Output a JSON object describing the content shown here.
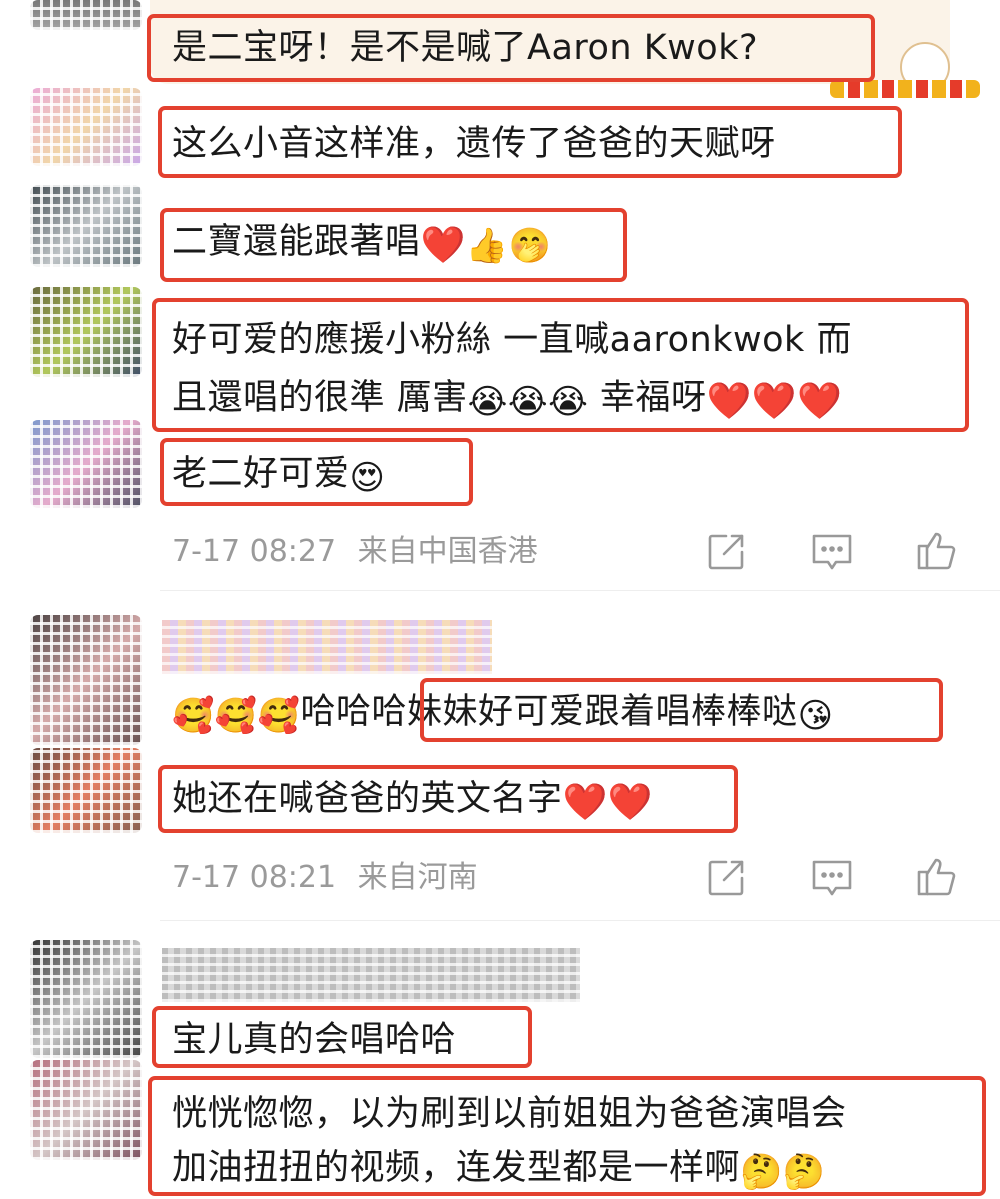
{
  "comment1": {
    "lines": [
      {
        "text": "是二宝呀！是不是喊了Aaron Kwok?",
        "emoji": []
      },
      {
        "text": "这么小音这样准，遗传了爸爸的天赋呀",
        "emoji": []
      },
      {
        "text": "二寶還能跟著唱",
        "emoji": [
          "❤️",
          "👍",
          "🤭"
        ]
      },
      {
        "text": "好可爱的應援小粉絲 一直喊aaronkwok 而",
        "emoji": []
      },
      {
        "text": "且還唱的很準 厲害",
        "emoji": [
          "😭",
          "😭",
          "😭"
        ],
        "suffix": " 幸福呀",
        "suffix_emoji": [
          "❤️",
          "❤️",
          "❤️"
        ]
      },
      {
        "text": "老二好可爱",
        "emoji": [
          "😍"
        ]
      }
    ],
    "time": "7-17 08:27",
    "location": "来自中国香港"
  },
  "comment2": {
    "prefix_emoji": [
      "🥰",
      "🥰",
      "🥰"
    ],
    "prefix_text": "哈哈哈",
    "lines": [
      {
        "text": "妹妹好可爱跟着唱棒棒哒",
        "emoji": [
          "😘"
        ]
      },
      {
        "text": "她还在喊爸爸的英文名字",
        "emoji": [
          "❤️",
          "❤️"
        ]
      }
    ],
    "time": "7-17 08:21",
    "location": "来自河南"
  },
  "comment3": {
    "lines": [
      {
        "text": "宝儿真的会唱哈哈",
        "emoji": []
      },
      {
        "text": "恍恍惚惚，以为刷到以前姐姐为爸爸演唱会",
        "emoji": []
      },
      {
        "text": "加油扭扭的视频，连发型都是一样啊",
        "emoji": [
          "🤔",
          "🤔"
        ]
      }
    ]
  },
  "icons": {
    "share": "share-icon",
    "comment": "comment-icon",
    "like": "thumbs-up-icon"
  },
  "colors": {
    "highlight_box": "#e3412f",
    "meta_text": "#9a9a9a"
  }
}
